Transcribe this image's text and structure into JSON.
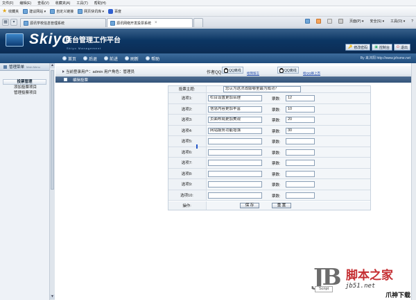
{
  "browser": {
    "menu": [
      "文件(F)",
      "编辑(E)",
      "查看(V)",
      "收藏夹(A)",
      "工具(T)",
      "帮助(H)"
    ],
    "favorites": [
      {
        "label": "收藏夹",
        "icon": "star-icon"
      },
      {
        "label": "建议网站 ▾",
        "icon": "suggest-icon"
      },
      {
        "label": "自定义链接",
        "icon": "link-icon"
      },
      {
        "label": "网页快讯库 ▾",
        "icon": "feed-icon"
      },
      {
        "label": "百度",
        "icon": "baidu-icon"
      }
    ],
    "tabs": [
      {
        "label": "源讯学校信息管理系统",
        "active": false
      },
      {
        "label": "源讯网络开发投票系统",
        "active": true
      }
    ],
    "tools": [
      "页面(P) ▾",
      "安全(S) ▾",
      "工具(O) ▾",
      "?"
    ]
  },
  "banner": {
    "logo": "Skiyo",
    "subtitle": "后台管理工作平台",
    "tagline": "Skiyo Management",
    "buttons": [
      "修改密码",
      "控制台",
      "退出"
    ]
  },
  "nav": {
    "items": [
      "首页",
      "后退",
      "前进",
      "刷新",
      "帮助"
    ],
    "right_text": "By 来沐阳 http://www.jzhsme.net"
  },
  "sidebar": {
    "title": "管理菜单",
    "subtitle": "Main Menu",
    "group": "投票管理",
    "items": [
      "添加投票项目",
      "管理投票项目"
    ]
  },
  "info_bar": {
    "user": "当前登录用户：admin  用户角色：管理员",
    "author_label": "作者QQ:",
    "qq_buttons": [
      {
        "label": "QQ离线",
        "link": "给我留言"
      },
      {
        "label": "QQ离线",
        "link": "给QQ群上百"
      }
    ]
  },
  "section": {
    "title": "编辑投票"
  },
  "form": {
    "topic_label": "投票主题:",
    "topic_value": "您认为这次改版哪里最为成功？",
    "value_label": "票数:",
    "options": [
      {
        "label": "选项1:",
        "text": "栏目设置更加合理",
        "votes": "12"
      },
      {
        "label": "选项2:",
        "text": "信息内容更加丰富",
        "votes": "10"
      },
      {
        "label": "选项3:",
        "text": "页面布局更加美观",
        "votes": "20"
      },
      {
        "label": "选项4:",
        "text": "网站服务功能增强",
        "votes": "30"
      },
      {
        "label": "选项5:",
        "text": "",
        "votes": ""
      },
      {
        "label": "选项6:",
        "text": "",
        "votes": ""
      },
      {
        "label": "选项7:",
        "text": "",
        "votes": ""
      },
      {
        "label": "选项8:",
        "text": "",
        "votes": ""
      },
      {
        "label": "选项9:",
        "text": "",
        "votes": ""
      },
      {
        "label": "选项10:",
        "text": "",
        "votes": ""
      }
    ],
    "action_label": "操作:",
    "save_label": "保 存",
    "reset_label": "重 置"
  },
  "watermark": {
    "jb": "JB",
    "script": "Script",
    "cn": "脚本之家",
    "site": "jb51.net",
    "download": "爪神下载网"
  }
}
